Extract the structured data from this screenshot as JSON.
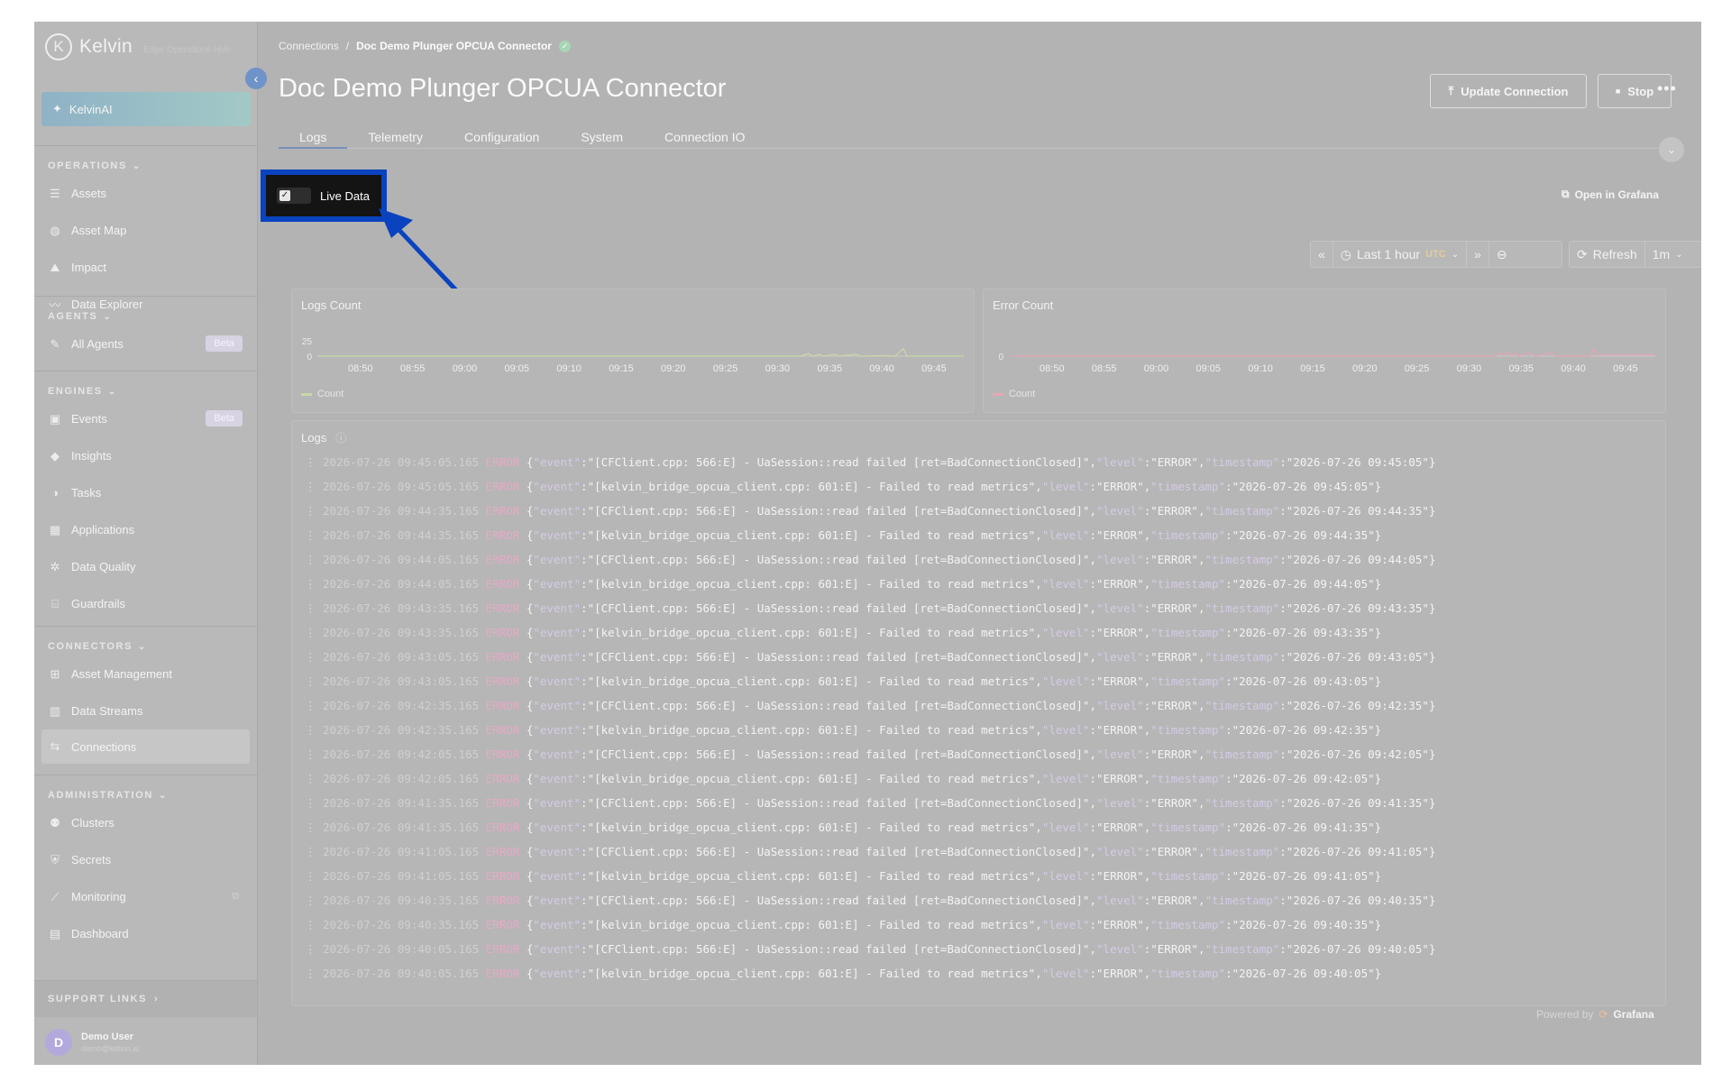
{
  "brand": {
    "name": "Kelvin",
    "subtitle": "Edge Operations Hub"
  },
  "sidebar": {
    "ai_label": "KelvinAI",
    "sections": [
      {
        "title": "OPERATIONS",
        "items": [
          {
            "label": "Assets",
            "icon": "assets-icon",
            "glyph": "☰"
          },
          {
            "label": "Asset Map",
            "icon": "globe-icon",
            "glyph": "◍"
          },
          {
            "label": "Impact",
            "icon": "impact-icon",
            "glyph": "⛰"
          },
          {
            "label": "Data Explorer",
            "icon": "pulse-icon",
            "glyph": "〰"
          }
        ]
      },
      {
        "title": "AGENTS",
        "items": [
          {
            "label": "All Agents",
            "icon": "agent-icon",
            "glyph": "✎",
            "badge": "Beta"
          }
        ]
      },
      {
        "title": "ENGINES",
        "items": [
          {
            "label": "Events",
            "icon": "events-icon",
            "glyph": "▣",
            "badge": "Beta"
          },
          {
            "label": "Insights",
            "icon": "tag-icon",
            "glyph": "◆"
          },
          {
            "label": "Tasks",
            "icon": "tasks-icon",
            "glyph": "◑"
          },
          {
            "label": "Applications",
            "icon": "grid-icon",
            "glyph": "▦"
          },
          {
            "label": "Data Quality",
            "icon": "gear-icon",
            "glyph": "✲"
          },
          {
            "label": "Guardrails",
            "icon": "barrier-icon",
            "glyph": "⌸"
          }
        ]
      },
      {
        "title": "CONNECTORS",
        "items": [
          {
            "label": "Asset Management",
            "icon": "hierarchy-icon",
            "glyph": "⊞"
          },
          {
            "label": "Data Streams",
            "icon": "bars-icon",
            "glyph": "▥"
          },
          {
            "label": "Connections",
            "icon": "connection-icon",
            "glyph": "⇆",
            "active": true
          }
        ]
      },
      {
        "title": "ADMINISTRATION",
        "items": [
          {
            "label": "Clusters",
            "icon": "cluster-icon",
            "glyph": "⚉"
          },
          {
            "label": "Secrets",
            "icon": "shield-icon",
            "glyph": "⛨"
          },
          {
            "label": "Monitoring",
            "icon": "chart-icon",
            "glyph": "⟋",
            "external": true
          },
          {
            "label": "Dashboard",
            "icon": "dashboard-icon",
            "glyph": "▤"
          }
        ]
      }
    ],
    "support_label": "SUPPORT LINKS",
    "user": {
      "initial": "D",
      "name": "Demo User",
      "email": "demo@kelvin.ai"
    }
  },
  "breadcrumb": {
    "parent": "Connections",
    "current": "Doc Demo Plunger OPCUA Connector"
  },
  "page_title": "Doc Demo Plunger OPCUA Connector",
  "actions": {
    "update": "Update Connection",
    "stop": "Stop",
    "more": "•••"
  },
  "tabs": [
    "Logs",
    "Telemetry",
    "Configuration",
    "System",
    "Connection IO"
  ],
  "active_tab": 0,
  "live_data": {
    "label": "Live Data",
    "checked": true
  },
  "grafana_link": "Open in Grafana",
  "time_controls": {
    "range": "Last 1 hour",
    "tz": "UTC",
    "refresh": "Refresh",
    "interval": "1m"
  },
  "colors": {
    "logs_series": "#c9d9a6",
    "error_series": "#e7a5b4",
    "annotation": "#0a43c0"
  },
  "chart_data": [
    {
      "type": "line",
      "title": "Logs Count",
      "x": [
        "08:50",
        "08:55",
        "09:00",
        "09:05",
        "09:10",
        "09:15",
        "09:20",
        "09:25",
        "09:30",
        "09:35",
        "09:40",
        "09:45"
      ],
      "yticks": [
        0,
        25
      ],
      "ylim": [
        0,
        35
      ],
      "series": [
        {
          "name": "Count",
          "points": [
            [
              0,
              0
            ],
            [
              56,
              0
            ],
            [
              57,
              4
            ],
            [
              57.5,
              0
            ],
            [
              58.3,
              3
            ],
            [
              58.8,
              0
            ],
            [
              60,
              3
            ],
            [
              60.5,
              0
            ],
            [
              62.5,
              3
            ],
            [
              63,
              0
            ],
            [
              66,
              1
            ],
            [
              67,
              0
            ],
            [
              67.5,
              6
            ],
            [
              68,
              12
            ],
            [
              68.4,
              0
            ],
            [
              75,
              0
            ]
          ]
        }
      ],
      "xmin": 0,
      "xmax": 75,
      "x_start_minute": 0
    },
    {
      "type": "line",
      "title": "Error Count",
      "x": [
        "08:50",
        "08:55",
        "09:00",
        "09:05",
        "09:10",
        "09:15",
        "09:20",
        "09:25",
        "09:30",
        "09:35",
        "09:40",
        "09:45"
      ],
      "yticks": [
        0
      ],
      "ylim": [
        0,
        35
      ],
      "series": [
        {
          "name": "Count",
          "points": [
            [
              0,
              0
            ],
            [
              56.5,
              0
            ],
            [
              57,
              5
            ],
            [
              57.4,
              2
            ],
            [
              57.8,
              6
            ],
            [
              58.2,
              1
            ],
            [
              58.8,
              5
            ],
            [
              59.2,
              0
            ],
            [
              60.5,
              6
            ],
            [
              61,
              0
            ],
            [
              63,
              5
            ],
            [
              63.4,
              0
            ],
            [
              67.5,
              0
            ],
            [
              67.8,
              11
            ],
            [
              68.2,
              2
            ],
            [
              68.6,
              3
            ],
            [
              69,
              1
            ],
            [
              69.5,
              3
            ],
            [
              70,
              1
            ],
            [
              70.5,
              3
            ],
            [
              71,
              1
            ],
            [
              71.5,
              3
            ],
            [
              72,
              1
            ],
            [
              72.5,
              3
            ],
            [
              73,
              1
            ],
            [
              73.5,
              3
            ],
            [
              74,
              1
            ],
            [
              74.5,
              3
            ],
            [
              75,
              1
            ]
          ]
        }
      ],
      "xmin": 0,
      "xmax": 75
    }
  ],
  "logs": {
    "title": "Logs",
    "level": "ERROR",
    "rows": [
      {
        "ts": "2026-07-26 09:45:05.165",
        "event": "[CFClient.cpp: 566:E] - UaSession::read failed [ret=BadConnectionClosed]",
        "tstamp": "2026-07-26 09:45:05"
      },
      {
        "ts": "2026-07-26 09:45:05.165",
        "event": "[kelvin_bridge_opcua_client.cpp: 601:E] - Failed to read metrics",
        "tstamp": "2026-07-26 09:45:05"
      },
      {
        "ts": "2026-07-26 09:44:35.165",
        "event": "[CFClient.cpp: 566:E] - UaSession::read failed [ret=BadConnectionClosed]",
        "tstamp": "2026-07-26 09:44:35"
      },
      {
        "ts": "2026-07-26 09:44:35.165",
        "event": "[kelvin_bridge_opcua_client.cpp: 601:E] - Failed to read metrics",
        "tstamp": "2026-07-26 09:44:35"
      },
      {
        "ts": "2026-07-26 09:44:05.165",
        "event": "[CFClient.cpp: 566:E] - UaSession::read failed [ret=BadConnectionClosed]",
        "tstamp": "2026-07-26 09:44:05"
      },
      {
        "ts": "2026-07-26 09:44:05.165",
        "event": "[kelvin_bridge_opcua_client.cpp: 601:E] - Failed to read metrics",
        "tstamp": "2026-07-26 09:44:05"
      },
      {
        "ts": "2026-07-26 09:43:35.165",
        "event": "[CFClient.cpp: 566:E] - UaSession::read failed [ret=BadConnectionClosed]",
        "tstamp": "2026-07-26 09:43:35"
      },
      {
        "ts": "2026-07-26 09:43:35.165",
        "event": "[kelvin_bridge_opcua_client.cpp: 601:E] - Failed to read metrics",
        "tstamp": "2026-07-26 09:43:35"
      },
      {
        "ts": "2026-07-26 09:43:05.165",
        "event": "[CFClient.cpp: 566:E] - UaSession::read failed [ret=BadConnectionClosed]",
        "tstamp": "2026-07-26 09:43:05"
      },
      {
        "ts": "2026-07-26 09:43:05.165",
        "event": "[kelvin_bridge_opcua_client.cpp: 601:E] - Failed to read metrics",
        "tstamp": "2026-07-26 09:43:05"
      },
      {
        "ts": "2026-07-26 09:42:35.165",
        "event": "[CFClient.cpp: 566:E] - UaSession::read failed [ret=BadConnectionClosed]",
        "tstamp": "2026-07-26 09:42:35"
      },
      {
        "ts": "2026-07-26 09:42:35.165",
        "event": "[kelvin_bridge_opcua_client.cpp: 601:E] - Failed to read metrics",
        "tstamp": "2026-07-26 09:42:35"
      },
      {
        "ts": "2026-07-26 09:42:05.165",
        "event": "[CFClient.cpp: 566:E] - UaSession::read failed [ret=BadConnectionClosed]",
        "tstamp": "2026-07-26 09:42:05"
      },
      {
        "ts": "2026-07-26 09:42:05.165",
        "event": "[kelvin_bridge_opcua_client.cpp: 601:E] - Failed to read metrics",
        "tstamp": "2026-07-26 09:42:05"
      },
      {
        "ts": "2026-07-26 09:41:35.165",
        "event": "[CFClient.cpp: 566:E] - UaSession::read failed [ret=BadConnectionClosed]",
        "tstamp": "2026-07-26 09:41:35"
      },
      {
        "ts": "2026-07-26 09:41:35.165",
        "event": "[kelvin_bridge_opcua_client.cpp: 601:E] - Failed to read metrics",
        "tstamp": "2026-07-26 09:41:35"
      },
      {
        "ts": "2026-07-26 09:41:05.165",
        "event": "[CFClient.cpp: 566:E] - UaSession::read failed [ret=BadConnectionClosed]",
        "tstamp": "2026-07-26 09:41:05"
      },
      {
        "ts": "2026-07-26 09:41:05.165",
        "event": "[kelvin_bridge_opcua_client.cpp: 601:E] - Failed to read metrics",
        "tstamp": "2026-07-26 09:41:05"
      },
      {
        "ts": "2026-07-26 09:40:35.165",
        "event": "[CFClient.cpp: 566:E] - UaSession::read failed [ret=BadConnectionClosed]",
        "tstamp": "2026-07-26 09:40:35"
      },
      {
        "ts": "2026-07-26 09:40:35.165",
        "event": "[kelvin_bridge_opcua_client.cpp: 601:E] - Failed to read metrics",
        "tstamp": "2026-07-26 09:40:35"
      },
      {
        "ts": "2026-07-26 09:40:05.165",
        "event": "[CFClient.cpp: 566:E] - UaSession::read failed [ret=BadConnectionClosed]",
        "tstamp": "2026-07-26 09:40:05"
      },
      {
        "ts": "2026-07-26 09:40:05.165",
        "event": "[kelvin_bridge_opcua_client.cpp: 601:E] - Failed to read metrics",
        "tstamp": "2026-07-26 09:40:05"
      }
    ]
  },
  "powered_by": {
    "prefix": "Powered by",
    "name": "Grafana"
  }
}
